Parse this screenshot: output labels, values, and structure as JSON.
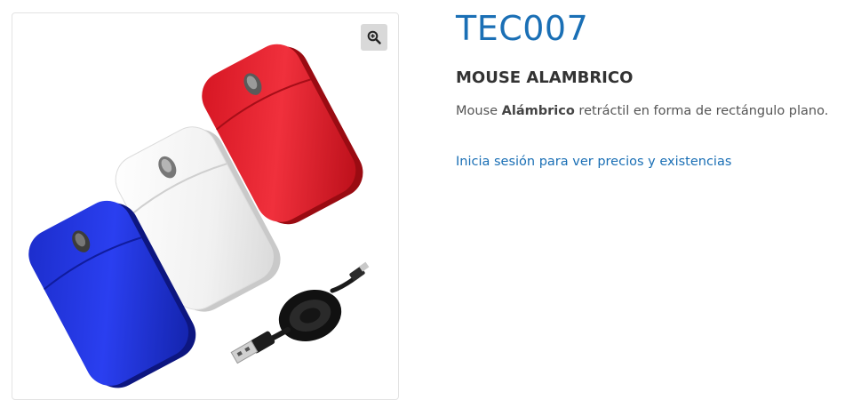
{
  "product": {
    "sku": "TEC007",
    "name": "MOUSE ALAMBRICO",
    "description": {
      "prefix": "Mouse ",
      "bold": "Alámbrico",
      "suffix": " retráctil en forma de rectángulo plano."
    },
    "login_link": "Inicia sesión para ver precios y existencias"
  },
  "gallery": {
    "zoom_icon": "zoom-in-icon"
  },
  "colors": {
    "accent": "#1a6fb5",
    "mouse_red": "#e0202c",
    "mouse_white": "#f2f2f2",
    "mouse_blue": "#1a2fd6"
  }
}
